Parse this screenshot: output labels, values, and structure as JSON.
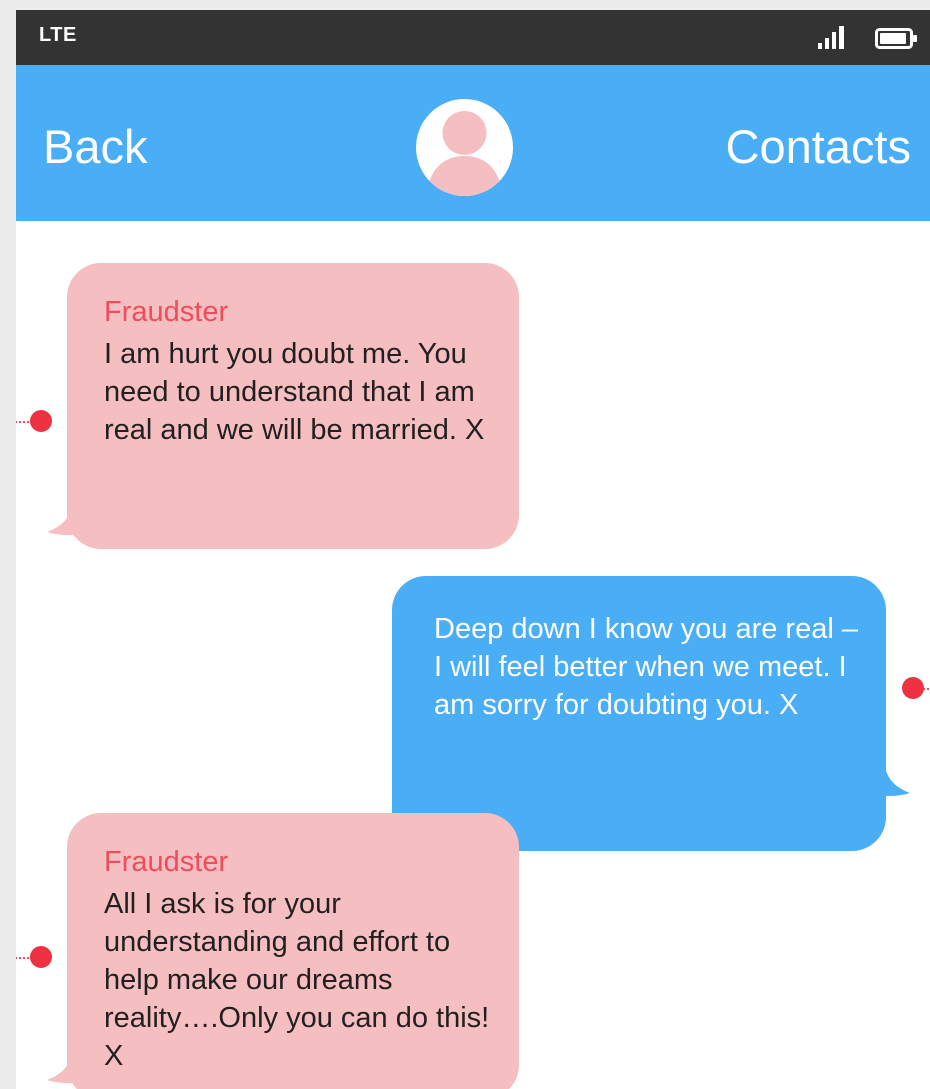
{
  "status_bar": {
    "network": "LTE",
    "signal_icon": "signal-bars-icon",
    "battery_icon": "battery-icon"
  },
  "header": {
    "back_label": "Back",
    "contacts_label": "Contacts",
    "avatar_icon": "user-avatar-icon"
  },
  "colors": {
    "status_bar": "#333333",
    "header": "#4aaef6",
    "received_bubble": "#f5bec0",
    "sent_bubble": "#4aaef6",
    "sender_name": "#ef4d5c",
    "marker": "#ee3241",
    "avatar_figure": "#f5bec0"
  },
  "messages": [
    {
      "direction": "received",
      "sender": "Fraudster",
      "text": "I am hurt you doubt me. You need to understand that I am real and we will be married. X"
    },
    {
      "direction": "sent",
      "text": "Deep down I know you are real – I will feel better when we meet. I am sorry for doubting you. X"
    },
    {
      "direction": "received",
      "sender": "Fraudster",
      "text": "All I ask is for your understanding and effort to help make our dreams reality….Only you can do this! X"
    }
  ]
}
